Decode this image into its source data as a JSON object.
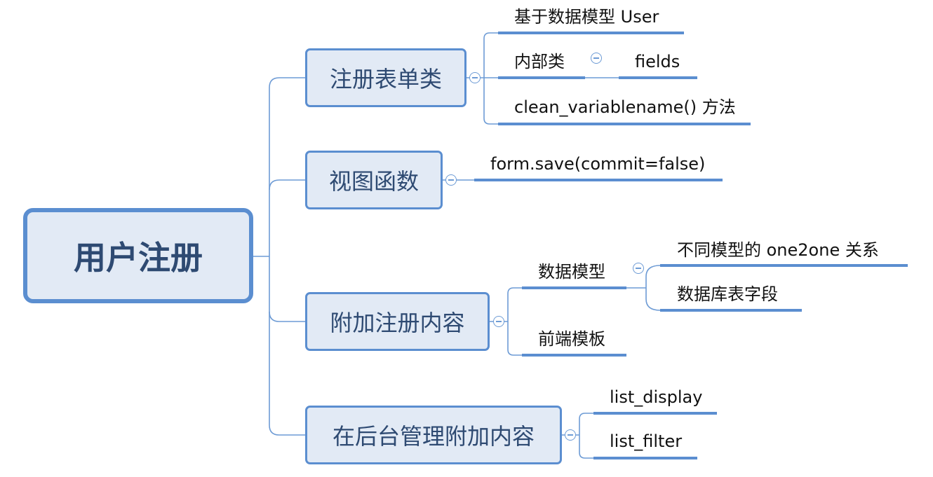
{
  "root": {
    "label": "用户注册"
  },
  "branches": [
    {
      "label": "注册表单类",
      "children": [
        {
          "label": "基于数据模型 User"
        },
        {
          "label": "内部类",
          "children": [
            {
              "label": "fields"
            }
          ]
        },
        {
          "label": "clean_variablename() 方法"
        }
      ]
    },
    {
      "label": "视图函数",
      "children": [
        {
          "label": "form.save(commit=false)"
        }
      ]
    },
    {
      "label": "附加注册内容",
      "children": [
        {
          "label": "数据模型",
          "children": [
            {
              "label": "不同模型的 one2one 关系"
            },
            {
              "label": "数据库表字段"
            }
          ]
        },
        {
          "label": "前端模板"
        }
      ]
    },
    {
      "label": "在后台管理附加内容",
      "children": [
        {
          "label": "list_display"
        },
        {
          "label": "list_filter"
        }
      ]
    }
  ],
  "colors": {
    "node_fill": "#E2EAF5",
    "node_border": "#5B8ED0",
    "node_text": "#2E4A72",
    "connector": "#6D9BD5",
    "underline": "#5B8ED0"
  }
}
